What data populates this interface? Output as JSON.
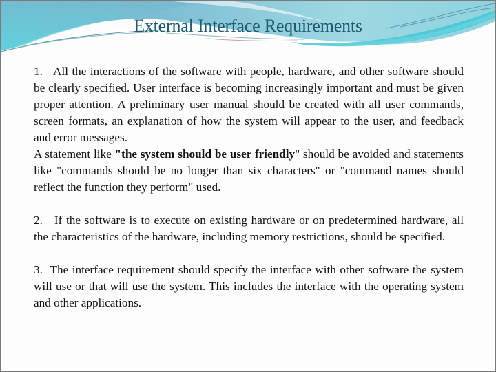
{
  "slide": {
    "title": "External Interface Requirements",
    "colors": {
      "title": "#1f5a6e",
      "header_dark": "#7bbcd3",
      "header_light": "#9ed8e2",
      "accent": "#3cc4d6"
    },
    "items": [
      {
        "number": "1.",
        "paragraphs": [
          {
            "text": "All the interactions of the software with people, hardware, and other software should be clearly specified. User interface is becoming increasingly important and must be given proper attention. A preliminary user manual should be created with all user commands, screen formats, an explanation of how the system will appear to the user, and feedback and error messages."
          },
          {
            "before": "A statement like ",
            "bold": "\"the system should be user friendly",
            "after": "\" should be avoided and statements like \"commands should be no longer than six characters\" or \"command names should reflect the function they perform\" used."
          }
        ]
      },
      {
        "number": "2.",
        "text": "If the software is to execute on existing hardware or on predetermined hardware, all the characteristics of the hardware, including memory restrictions, should be specified."
      },
      {
        "number": "3.",
        "text": "The interface requirement should specify the interface with other software the system will use or that will use the system. This includes the interface with the operating system and other applications."
      }
    ]
  }
}
